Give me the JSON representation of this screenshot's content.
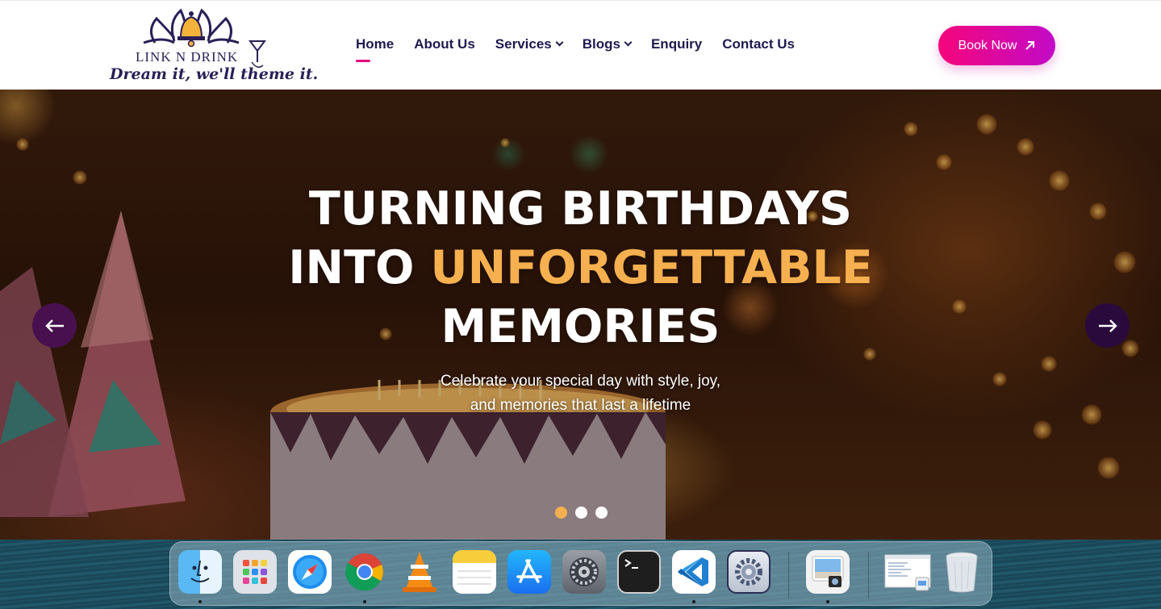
{
  "brand": {
    "name": "LINK N DRINK",
    "tagline": "Dream it, we'll theme it."
  },
  "nav": {
    "items": [
      {
        "label": "Home",
        "active": true,
        "dropdown": false
      },
      {
        "label": "About Us",
        "active": false,
        "dropdown": false
      },
      {
        "label": "Services",
        "active": false,
        "dropdown": true
      },
      {
        "label": "Blogs",
        "active": false,
        "dropdown": true
      },
      {
        "label": "Enquiry",
        "active": false,
        "dropdown": false
      },
      {
        "label": "Contact Us",
        "active": false,
        "dropdown": false
      }
    ],
    "book_button": {
      "label": "Book Now",
      "icon": "arrow-up-right-icon"
    }
  },
  "hero": {
    "title_line1": "TURNING BIRTHDAYS",
    "title_line2_white": "INTO",
    "title_line2_accent": "UNFORGETTABLE",
    "title_line3": "MEMORIES",
    "subtitle_line1": "Celebrate your special day with style, joy,",
    "subtitle_line2": "and memories that last a lifetime",
    "prev_icon": "arrow-left-icon",
    "next_icon": "arrow-right-icon",
    "slides_total": 3,
    "active_slide": 1
  },
  "colors": {
    "brand_navy": "#1e1a4f",
    "accent_pink": "#e5067b",
    "accent_purple": "#c20ac8",
    "accent_gold": "#f6b04f"
  },
  "dock": {
    "apps": [
      {
        "name": "Finder",
        "icon": "finder-icon",
        "running": true
      },
      {
        "name": "Launchpad",
        "icon": "launchpad-icon",
        "running": false
      },
      {
        "name": "Safari",
        "icon": "safari-icon",
        "running": false
      },
      {
        "name": "Chrome",
        "icon": "chrome-icon",
        "running": true
      },
      {
        "name": "VLC",
        "icon": "vlc-icon",
        "running": false
      },
      {
        "name": "Notes",
        "icon": "notes-icon",
        "running": false
      },
      {
        "name": "App Store",
        "icon": "app-store-icon",
        "running": false
      },
      {
        "name": "System Settings",
        "icon": "system-settings-icon",
        "running": false
      },
      {
        "name": "Terminal",
        "icon": "terminal-icon",
        "running": false
      },
      {
        "name": "VS Code",
        "icon": "vscode-icon",
        "running": true
      },
      {
        "name": "Automator",
        "icon": "gear-app-icon",
        "running": false
      },
      {
        "name": "Preview",
        "icon": "preview-icon",
        "running": true
      },
      {
        "name": "Document",
        "icon": "document-thumbnail-icon",
        "running": false
      },
      {
        "name": "Trash",
        "icon": "trash-icon",
        "running": false
      }
    ]
  }
}
